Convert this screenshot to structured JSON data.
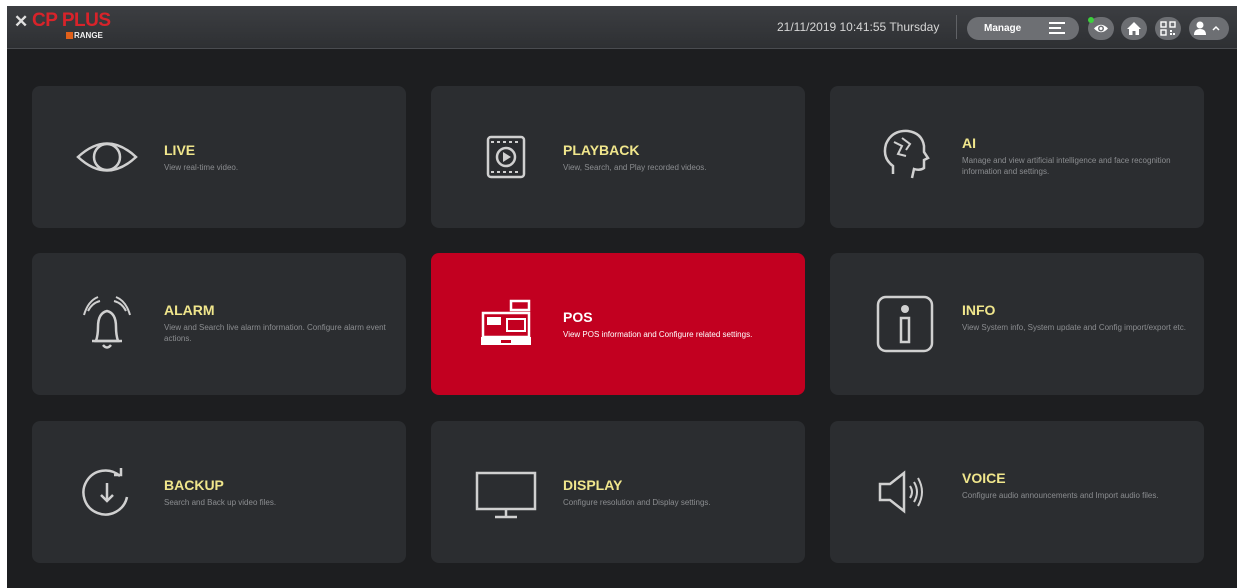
{
  "header": {
    "logo_x": "✕",
    "logo_brand": "CP PLUS",
    "logo_sub": "RANGE",
    "datetime": "21/11/2019 10:41:55 Thursday",
    "manage_label": "Manage"
  },
  "icons": {
    "menu": "hamburger-icon",
    "preview": "eye-icon",
    "home": "home-icon",
    "qr": "qr-code-icon",
    "user": "user-icon"
  },
  "colors": {
    "accent": "#c20020",
    "title": "#f0e68c",
    "status_online": "#3ccf3c"
  },
  "tiles": [
    {
      "title": "LIVE",
      "desc": "View real-time video.",
      "icon": "eye-icon"
    },
    {
      "title": "PLAYBACK",
      "desc": "View, Search, and Play recorded videos.",
      "icon": "playback-icon"
    },
    {
      "title": "AI",
      "desc": "Manage and view artificial intelligence and face recognition information and settings.",
      "icon": "ai-head-icon"
    },
    {
      "title": "ALARM",
      "desc": "View and Search live alarm information. Configure alarm event actions.",
      "icon": "alarm-bell-icon"
    },
    {
      "title": "POS",
      "desc": "View POS information and Configure related settings.",
      "icon": "cash-register-icon",
      "selected": true
    },
    {
      "title": "INFO",
      "desc": "View System info, System update and Config import/export etc.",
      "icon": "info-icon"
    },
    {
      "title": "BACKUP",
      "desc": "Search and Back up video files.",
      "icon": "backup-icon"
    },
    {
      "title": "DISPLAY",
      "desc": "Configure resolution and Display settings.",
      "icon": "monitor-icon"
    },
    {
      "title": "VOICE",
      "desc": "Configure audio announcements and Import audio files.",
      "icon": "speaker-icon"
    }
  ]
}
